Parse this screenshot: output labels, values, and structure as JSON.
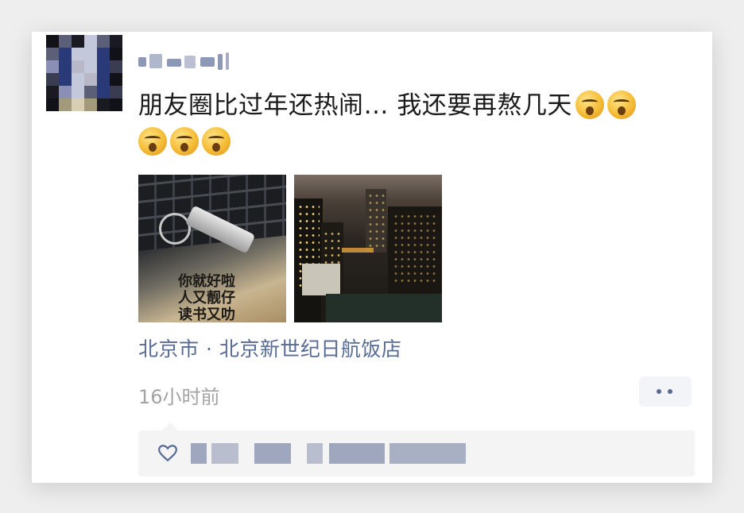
{
  "post": {
    "author": {
      "name_blurred": true
    },
    "text": "朋友圈比过年还热闹… 我还要再熬几天",
    "emoji_count": 5,
    "emoji_name": "sleepy-face",
    "photos": [
      {
        "name": "photo-usb-keyboard",
        "caption_lines": [
          "你就好啦",
          "人又靓仔",
          "读书又叻"
        ]
      },
      {
        "name": "photo-city-night"
      }
    ],
    "location": "北京市 · 北京新世纪日航饭店",
    "timestamp": "16小时前",
    "likes_blurred": true
  },
  "colors": {
    "link": "#576b95",
    "timestamp": "#a3a3a3",
    "text": "#1b1b1b",
    "likes_bg": "#f4f4f4"
  },
  "icons": {
    "more": "more-dots-icon",
    "like": "heart-icon"
  }
}
